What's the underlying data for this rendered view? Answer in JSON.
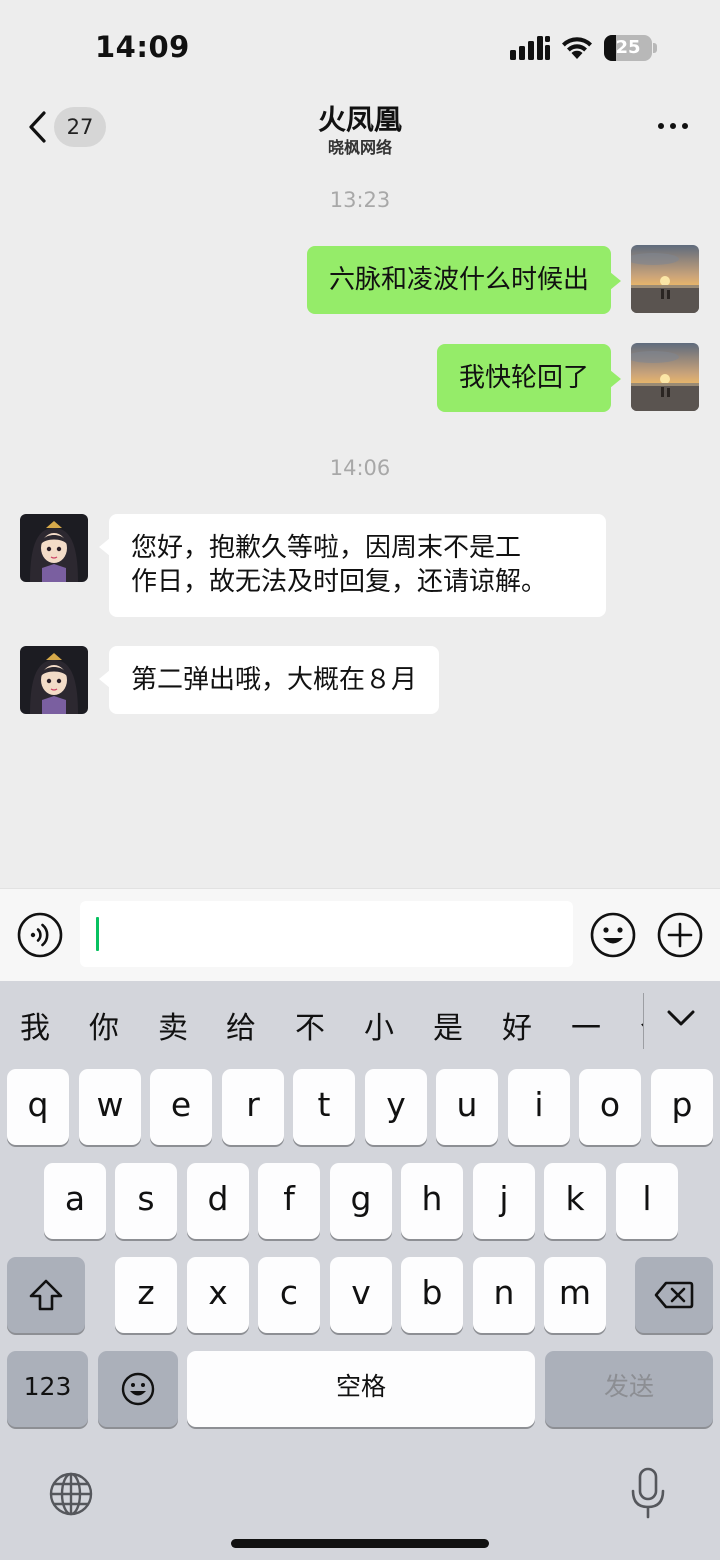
{
  "status_bar": {
    "time": "14:09",
    "battery_level": "25",
    "battery_fraction": 0.25
  },
  "header": {
    "unread_count": "27",
    "title": "火凤凰",
    "subtitle": "晓枫网络"
  },
  "messages": [
    {
      "type": "timestamp",
      "text": "13:23"
    },
    {
      "type": "outgoing",
      "text": "六脉和凌波什么时候出",
      "avatar": "sunset-beach-avatar"
    },
    {
      "type": "outgoing",
      "text": "我快轮回了",
      "avatar": "sunset-beach-avatar"
    },
    {
      "type": "timestamp",
      "text": "14:06"
    },
    {
      "type": "incoming",
      "lines": [
        "您好，抱歉久等啦，因周末不是工",
        "作日，故无法及时回复，还请谅解。"
      ],
      "avatar": "anime-girl-avatar"
    },
    {
      "type": "incoming",
      "text": "第二弹出哦，大概在８月",
      "avatar": "anime-girl-avatar"
    }
  ],
  "input": {
    "value": "",
    "accent_color": "#07c160"
  },
  "keyboard": {
    "candidates": [
      "我",
      "你",
      "卖",
      "给",
      "不",
      "小",
      "是",
      "好",
      "一",
      "个"
    ],
    "row1": [
      "q",
      "w",
      "e",
      "r",
      "t",
      "y",
      "u",
      "i",
      "o",
      "p"
    ],
    "row2": [
      "a",
      "s",
      "d",
      "f",
      "g",
      "h",
      "j",
      "k",
      "l"
    ],
    "row3": [
      "z",
      "x",
      "c",
      "v",
      "b",
      "n",
      "m"
    ],
    "numbers_key": "123",
    "space_key": "空格",
    "send_key": "发送"
  },
  "colors": {
    "outgoing_bubble": "#95ec69",
    "incoming_bubble": "#ffffff",
    "background": "#ededed"
  }
}
